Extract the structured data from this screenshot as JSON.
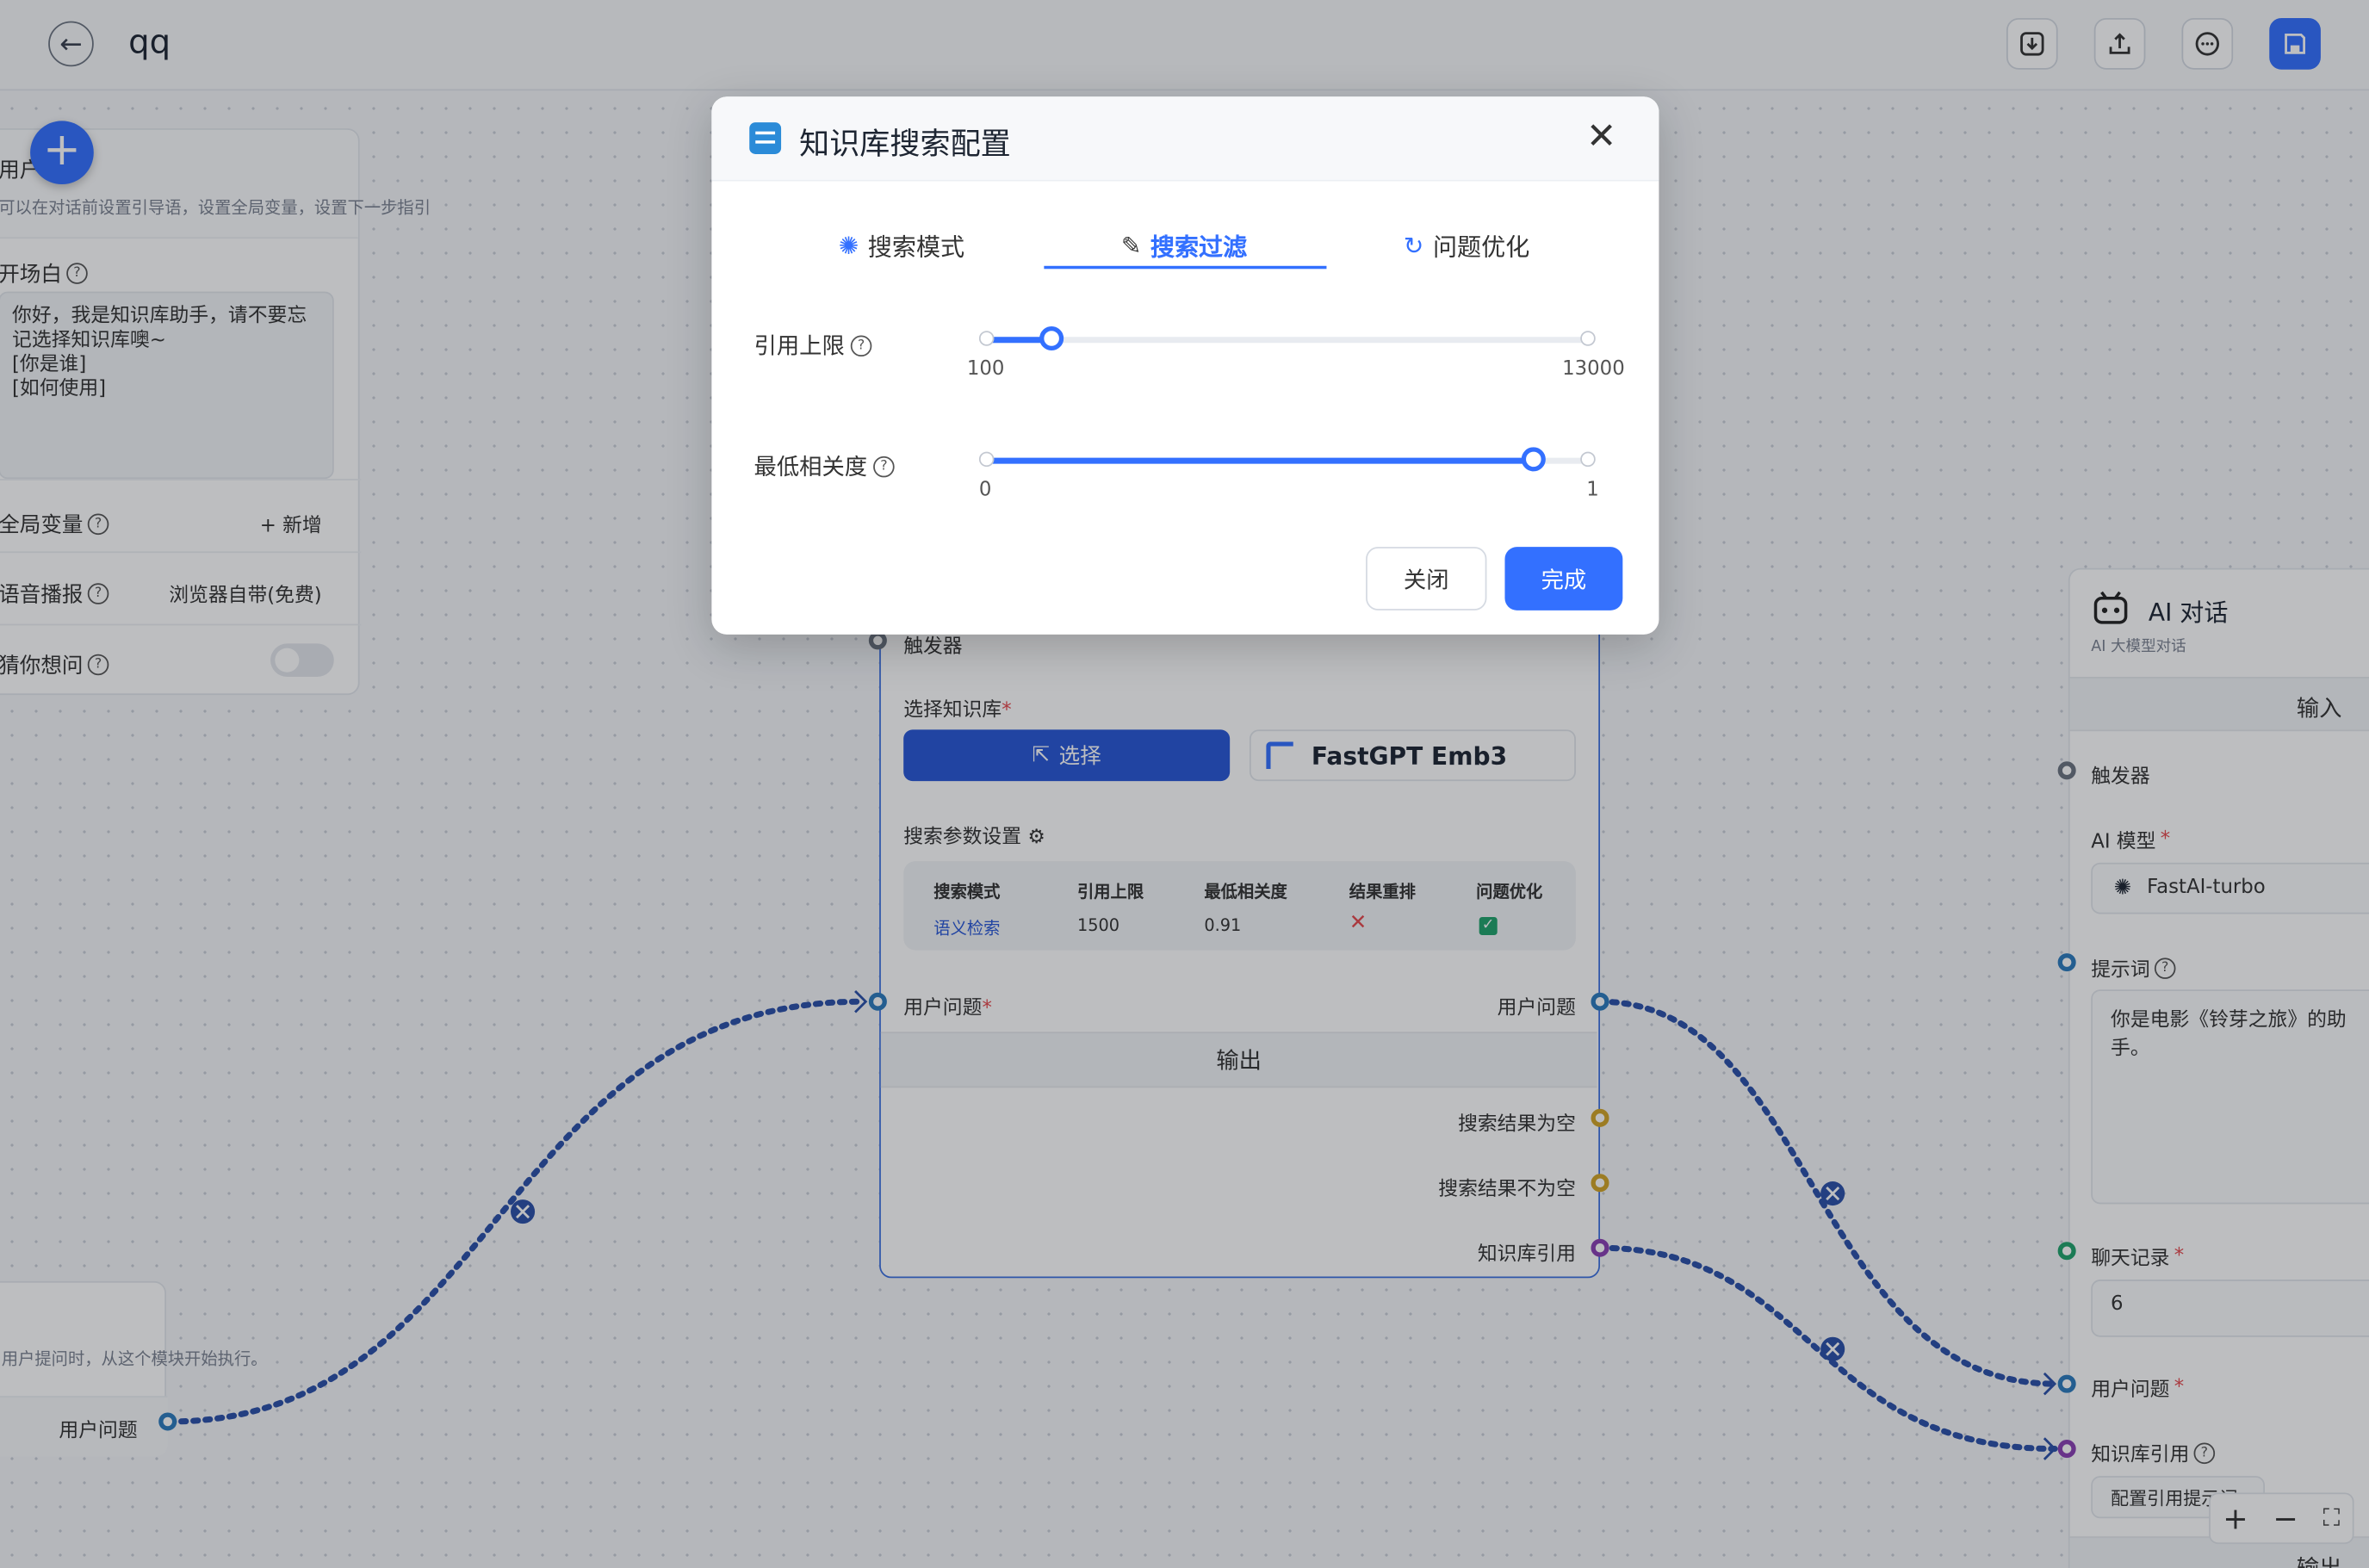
{
  "header": {
    "title": "qq"
  },
  "left_panel": {
    "title": "用户引导",
    "description": "可以在对话前设置引导语，设置全局变量，设置下一步指引",
    "welcome_label": "开场白",
    "welcome_text": "你好，我是知识库助手，请不要忘记选择知识库噢~\n[你是谁]\n[如何使用]",
    "variables_label": "全局变量",
    "variables_action": "+ 新增",
    "tts_label": "语音播报",
    "tts_value": "浏览器自带(免费)",
    "guess_label": "猜你想问"
  },
  "start_node": {
    "description": "用户提问时，从这个模块开始执行。",
    "output_label": "用户问题"
  },
  "kb_node": {
    "trigger_label": "触发器",
    "select_kb_label": "选择知识库",
    "select_button": "选择",
    "kb_name": "FastGPT Emb3",
    "params_label": "搜索参数设置",
    "param_headers": [
      "搜索模式",
      "引用上限",
      "最低相关度",
      "结果重排",
      "问题优化"
    ],
    "param_values": {
      "mode": "语义检索",
      "limit": "1500",
      "similarity": "0.91",
      "rerank": "✕",
      "optimize": "✓"
    },
    "user_question_in": "用户问题",
    "user_question_out": "用户问题",
    "output_band": "输出",
    "outputs": [
      "搜索结果为空",
      "搜索结果不为空",
      "知识库引用"
    ]
  },
  "ai_node": {
    "title": "AI 对话",
    "subtitle": "AI 大模型对话",
    "input_band": "输入",
    "trigger_label": "触发器",
    "model_label": "AI 模型",
    "model_value": "FastAI-turbo",
    "prompt_label": "提示词",
    "prompt_value": "你是电影《铃芽之旅》的助手。",
    "history_label": "聊天记录",
    "history_value": "6",
    "user_question_label": "用户问题",
    "quote_label": "知识库引用",
    "quote_button": "配置引用提示词",
    "output_band": "输出"
  },
  "modal": {
    "title": "知识库搜索配置",
    "tabs": [
      {
        "label": "搜索模式",
        "icon": "settings-icon",
        "active": false
      },
      {
        "label": "搜索过滤",
        "icon": "filter-icon",
        "active": true
      },
      {
        "label": "问题优化",
        "icon": "refresh-icon",
        "active": false
      }
    ],
    "quote_limit": {
      "label": "引用上限",
      "min": "100",
      "max": "13000",
      "value": 1500
    },
    "min_similarity": {
      "label": "最低相关度",
      "min": "0",
      "max": "1",
      "value": 0.91
    },
    "close_button": "关闭",
    "done_button": "完成"
  },
  "colors": {
    "accent": "#3370ff",
    "edge": "#2a4fa8"
  }
}
